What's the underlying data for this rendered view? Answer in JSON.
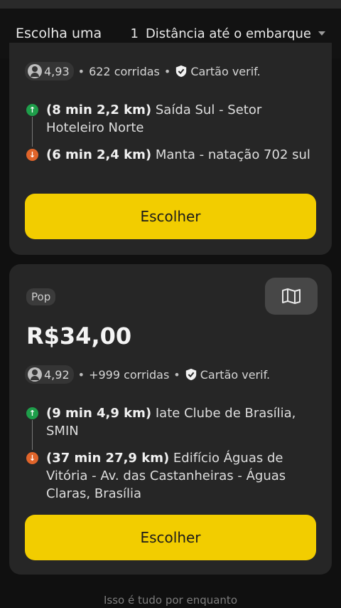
{
  "header": {
    "title": "Escolha uma",
    "sort_count": "1",
    "sort_label": "Distância até o embarque"
  },
  "offers": [
    {
      "rating": "4,93",
      "rides": "622 corridas",
      "verified": "Cartão verif.",
      "pickup_time": "(8 min 2,2 km)",
      "pickup_place": "Saída Sul - Setor Hoteleiro Norte",
      "dropoff_time": "(6 min 2,4 km)",
      "dropoff_place": "Manta - natação 702 sul",
      "button": "Escolher"
    },
    {
      "badge": "Pop",
      "price": "R$34,00",
      "rating": "4,92",
      "rides": "+999 corridas",
      "verified": "Cartão verif.",
      "pickup_time": "(9 min 4,9 km)",
      "pickup_place": "Iate Clube de Brasília, SMIN",
      "dropoff_time": "(37 min 27,9 km)",
      "dropoff_place": "Edifício Águas de Vitória - Av. das Castanheiras - Águas Claras, Brasília",
      "button": "Escolher"
    }
  ],
  "footer_text": "Isso é tudo por enquanto",
  "colors": {
    "accent": "#f2cd00",
    "pickup": "#1e9e4a",
    "dropoff": "#e0642a",
    "card": "#262626",
    "background": "#101010"
  },
  "icons": {
    "rating": "user-circle-icon",
    "verified": "shield-check-icon",
    "pickup": "arrow-up-icon",
    "dropoff": "arrow-down-icon",
    "map": "map-icon",
    "sort": "chevron-down-icon"
  }
}
